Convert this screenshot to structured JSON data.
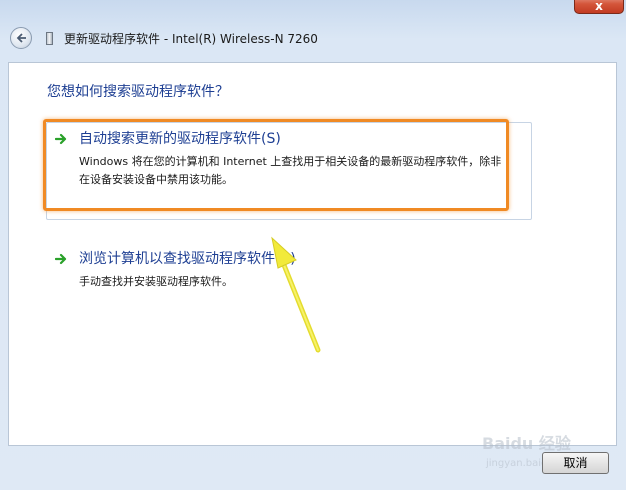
{
  "window": {
    "title": "更新驱动程序软件 - Intel(R) Wireless-N 7260",
    "close_label": "x"
  },
  "page": {
    "question": "您想如何搜索驱动程序软件？"
  },
  "options": [
    {
      "title": "自动搜索更新的驱动程序软件(S)",
      "description": "Windows 将在您的计算机和 Internet 上查找用于相关设备的最新驱动程序软件，除非在设备安装设备中禁用该功能。"
    },
    {
      "title": "浏览计算机以查找驱动程序软件(R)",
      "description": "手动查找并安装驱动程序软件。"
    }
  ],
  "footer": {
    "cancel_label": "取消"
  },
  "watermark": {
    "brand": "Baidu 经验",
    "url": "jingyan.baidu.com"
  },
  "colors": {
    "accent_text": "#1e3f93",
    "highlight_orange": "#f08a24",
    "arrow_green": "#2aa12a",
    "annotation_yellow": "#f2ea3a"
  },
  "icons": {
    "back": "back-arrow-icon",
    "device": "device-icon",
    "option_arrow": "green-arrow-icon",
    "close": "close-icon"
  }
}
